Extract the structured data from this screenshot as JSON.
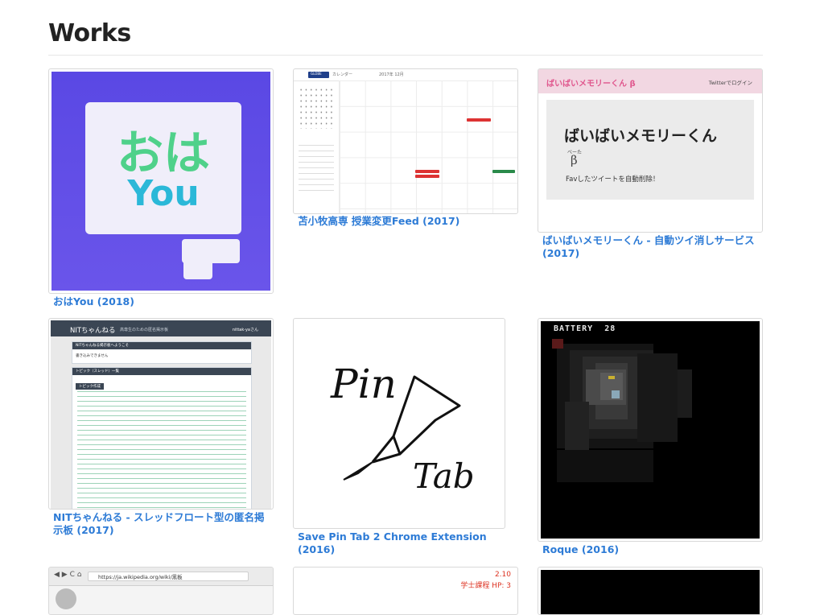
{
  "page": {
    "title": "Works"
  },
  "works": [
    {
      "caption": "おはYou (2018)",
      "thumb": {
        "line1": "おは",
        "line2": "You"
      }
    },
    {
      "caption": "苫小牧高専 授業変更Feed (2017)",
      "thumb": {
        "app": "カレンダー",
        "month": "2017年 12月",
        "logo": "GLOBE"
      }
    },
    {
      "caption": "ばいばいメモリーくん - 自動ツイ消しサービス (2017)",
      "thumb": {
        "logo": "ばいばいメモリーくん β",
        "login": "Twitterでログイン",
        "headline": "ばいばいメモリーくん",
        "beta_reading": "べーた",
        "beta_symbol": "β",
        "description": "Favしたツイートを自動削除！"
      }
    },
    {
      "caption": "NITちゃんねる - スレッドフロート型の匿名掲示板 (2017)",
      "thumb": {
        "brand": "NITちゃんねる",
        "tagline": "高専生のための匿名掲示板",
        "user": "nittak-yaさん",
        "welcome": "NITちゃんねる掲示板へようこそ",
        "notice": "書き込みできません",
        "topics_header": "トピック（スレッド）一覧",
        "create_button": "トピック作成"
      }
    },
    {
      "caption": "Save Pin Tab 2 Chrome Extension (2016)",
      "thumb": {
        "word1": "Pin",
        "word2": "Tab"
      }
    },
    {
      "caption": "Roque (2016)",
      "thumb": {
        "battery_label": "BATTERY",
        "battery_value": "28"
      }
    },
    {
      "caption": "",
      "thumb": {
        "url": "https://ja.wikipedia.org/wiki/黒板"
      }
    },
    {
      "caption": "",
      "thumb": {
        "stat1": "2.10",
        "stat2": "学士課程 HP: 3"
      }
    },
    {
      "caption": "",
      "thumb": {}
    }
  ],
  "colors": {
    "link": "#2d7bd6",
    "ohayou_bg": "#5a48e4",
    "ohayou_green": "#4fd18a",
    "ohayou_blue": "#2bb8d8",
    "nit_header": "#3b4654",
    "baibai_pink": "#e0568d"
  }
}
